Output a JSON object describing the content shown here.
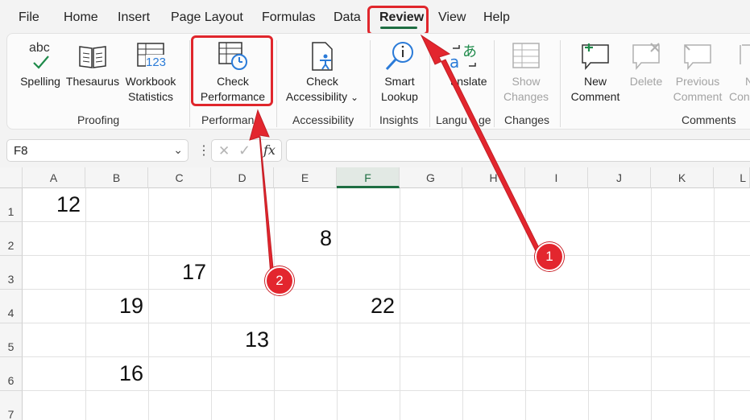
{
  "menu": {
    "tabs": [
      {
        "label": "File"
      },
      {
        "label": "Home"
      },
      {
        "label": "Insert"
      },
      {
        "label": "Page Layout"
      },
      {
        "label": "Formulas"
      },
      {
        "label": "Data"
      },
      {
        "label": "Review"
      },
      {
        "label": "View"
      },
      {
        "label": "Help"
      }
    ],
    "active_tab": "Review"
  },
  "ribbon": {
    "groups": {
      "proofing": "Proofing",
      "performance": "Performan",
      "accessibility": "Accessibility",
      "insights": "Insights",
      "language": "Langu",
      "language_tail": "ge",
      "changes": "Changes",
      "comments": "Comments"
    },
    "buttons": {
      "spelling": {
        "icon_text": "abc",
        "label": "Spelling"
      },
      "thesaurus": {
        "label": "Thesaurus"
      },
      "workbook_statistics": {
        "icon_text": "123",
        "line1": "Workbook",
        "line2": "Statistics"
      },
      "check_performance": {
        "line1": "Check",
        "line2": "Performance"
      },
      "check_accessibility": {
        "line1": "Check",
        "line2": "Accessibility",
        "caret": "⌄"
      },
      "smart_lookup": {
        "line1": "Smart",
        "line2": "Lookup"
      },
      "translate": {
        "label": "anslate"
      },
      "show_changes": {
        "line1": "Show",
        "line2": "Changes"
      },
      "new_comment": {
        "line1": "New",
        "line2": "Comment"
      },
      "delete": {
        "label": "Delete"
      },
      "previous_comment": {
        "line1": "Previous",
        "line2": "Comment"
      },
      "next_comment": {
        "line1": "N",
        "line2": "Con"
      }
    }
  },
  "formula_bar": {
    "name_box": "F8",
    "name_box_caret": "⌄",
    "more": "⋮",
    "cancel": "✕",
    "enter": "✓",
    "fx": "fx",
    "formula": ""
  },
  "sheet": {
    "columns": [
      "A",
      "B",
      "C",
      "D",
      "E",
      "F",
      "G",
      "H",
      "I",
      "J",
      "K",
      "L"
    ],
    "selected_column": "F",
    "rows": [
      "1",
      "2",
      "3",
      "4",
      "5",
      "6",
      "7"
    ],
    "cells": {
      "A1": "12",
      "E2": "8",
      "C3": "17",
      "B4": "19",
      "F4": "22",
      "D5": "13",
      "B6": "16"
    }
  },
  "annotations": {
    "badge1": "1",
    "badge2": "2",
    "color": "#e3262e"
  },
  "colors": {
    "accent_green": "#1e6e42",
    "highlight_red": "#e0262c"
  }
}
